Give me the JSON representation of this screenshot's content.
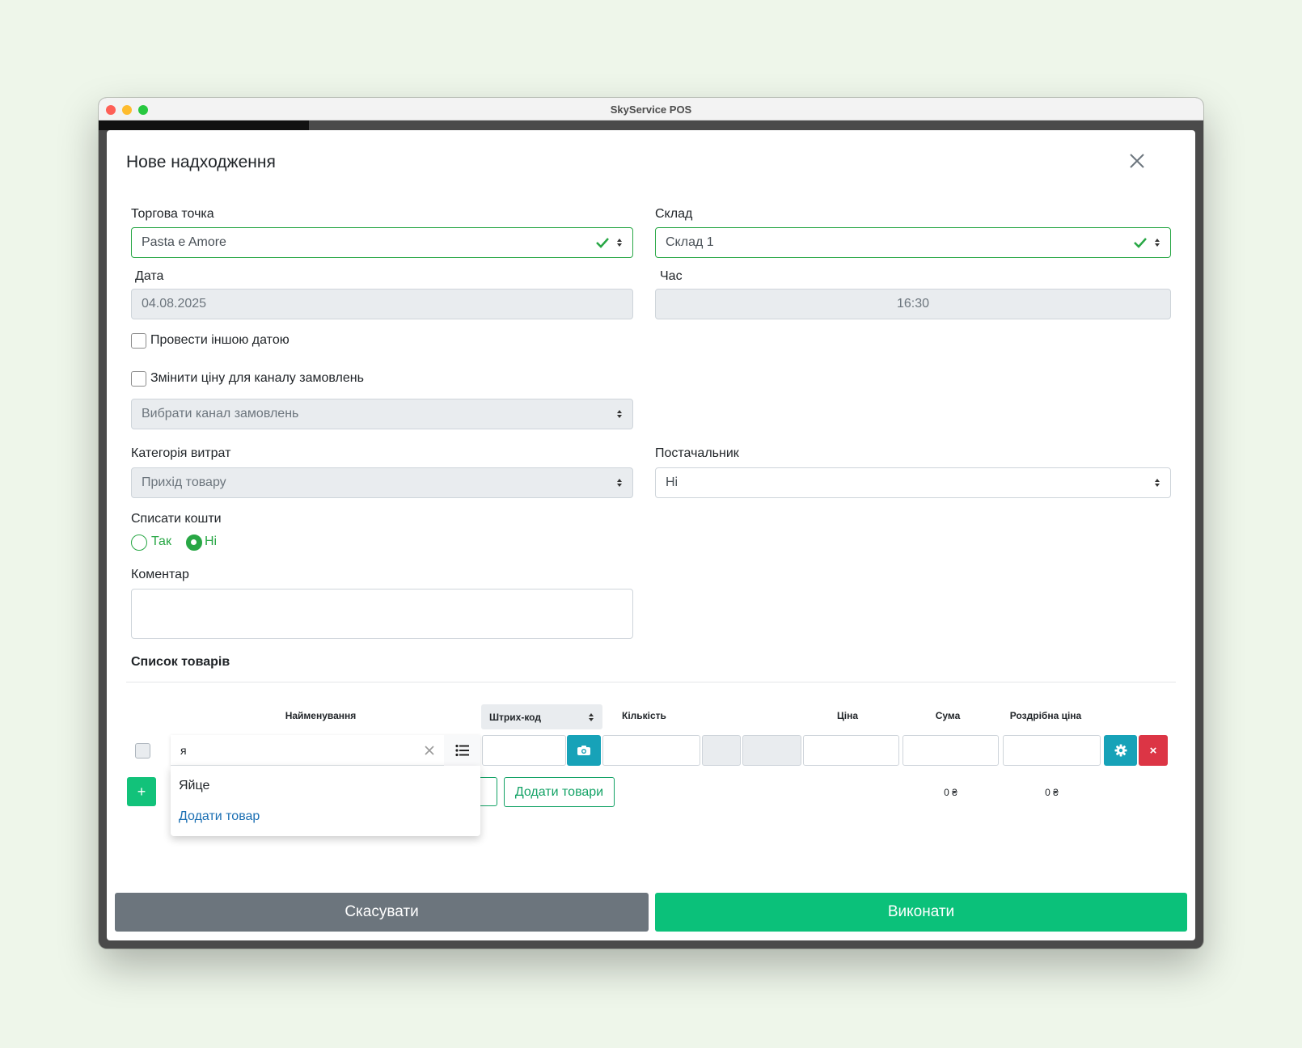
{
  "window": {
    "title": "SkyService POS"
  },
  "modal": {
    "title": "Нове надходження"
  },
  "form": {
    "outlet": {
      "label": "Торгова точка",
      "value": "Pasta e Amore"
    },
    "warehouse": {
      "label": "Склад",
      "value": "Склад 1"
    },
    "date": {
      "label": "Дата",
      "value": "04.08.2025"
    },
    "time": {
      "label": "Час",
      "value": "16:30"
    },
    "other_date": {
      "label": "Провести іншою датою",
      "checked": false
    },
    "change_price": {
      "label": "Змінити ціну для каналу замовлень",
      "checked": false
    },
    "channel": {
      "placeholder": "Вибрати канал замовлень"
    },
    "expense_category": {
      "label": "Категорія витрат",
      "value": "Прихід товару"
    },
    "supplier": {
      "label": "Постачальник",
      "value": "Ні"
    },
    "write_off": {
      "label": "Списати кошти",
      "options": [
        "Так",
        "Ні"
      ],
      "selected": "Ні"
    },
    "comment": {
      "label": "Коментар",
      "value": ""
    }
  },
  "products": {
    "title": "Список товарів",
    "headers": {
      "name": "Найменування",
      "barcode": "Штрих-код",
      "qty": "Кількість",
      "price": "Ціна",
      "sum": "Сума",
      "retail": "Роздрібна ціна"
    },
    "search": {
      "value": "я"
    },
    "suggestions": [
      "Яйце"
    ],
    "add_product_link": "Додати товар",
    "add_plus": "+",
    "add_goods_button": "Додати товари",
    "remove_icon": "×",
    "totals": {
      "sum": "0 ₴",
      "retail": "0 ₴"
    }
  },
  "footer": {
    "cancel": "Скасувати",
    "submit": "Виконати"
  },
  "colors": {
    "success": "#28a745",
    "primary_btn": "#0bc17a",
    "cancel_btn": "#6c757d",
    "info": "#17a2b8",
    "danger": "#dc3545"
  }
}
